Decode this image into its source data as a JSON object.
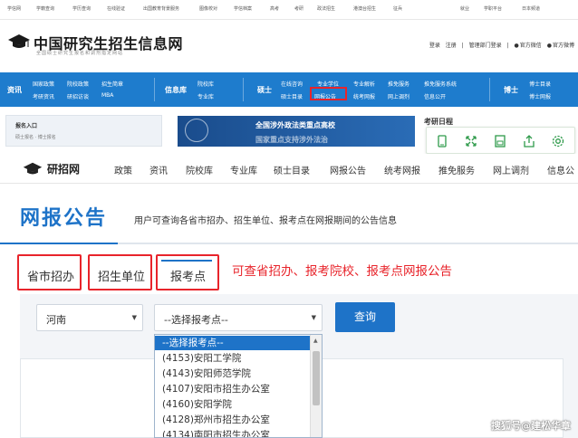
{
  "portal_links": [
    "学信网",
    "学籍查询",
    "学历查询",
    "在线验证",
    "出国教育背景服务",
    "图像校对",
    "学信档案",
    "高考",
    "考研",
    "政法招生",
    "港澳台招生",
    "征兵",
    "就业",
    "学职平台",
    "日本频道"
  ],
  "chsi": {
    "title": "中国研究生招生信息网",
    "subtitle": "全国硕士研究生报名和调剂指定网站",
    "login": "登录",
    "register": "注册",
    "admin_login": "管理部门登录",
    "wechat": "官方微信",
    "weibo": "官方微博"
  },
  "bluenav": {
    "zixun": {
      "header": "资讯",
      "items": [
        "国家政策",
        "院校政策",
        "招生简章",
        "考研资讯",
        "研招访谈",
        "MBA"
      ]
    },
    "xinxiku": {
      "header": "信息库",
      "items": [
        "院校库",
        "专业库"
      ]
    },
    "shuoshi": {
      "header": "硕士",
      "row1": [
        "在线咨询",
        "专业学位",
        "专业解析",
        "推免服务",
        "推免服务系统"
      ],
      "row2": [
        "硕士目录",
        "网报公告",
        "统考网报",
        "网上调剂",
        "信息公开"
      ]
    },
    "boshi": {
      "header": "博士",
      "items": [
        "博士目录",
        "博士网报"
      ]
    }
  },
  "middle": {
    "signup_entry": "报名入口",
    "signup_links": "硕士报名 · 博士报名",
    "banner_line1": "全国涉外政法类重点高校",
    "banner_line2": "国家重点支持涉外法治",
    "calendar": "考研日程"
  },
  "toolbar_icons": [
    "tablet-icon",
    "expand-icon",
    "save-icon",
    "share-icon",
    "settings-icon"
  ],
  "yzw": {
    "title": "研招网",
    "nav": [
      "政策",
      "资讯",
      "院校库",
      "专业库",
      "硕士目录",
      "网报公告",
      "统考网报",
      "推免服务",
      "网上调剂",
      "信息公"
    ]
  },
  "page": {
    "title": "网报公告",
    "description": "用户可查询各省市招办、招生单位、报考点在网报期间的公告信息"
  },
  "tabs": [
    "省市招办",
    "招生单位",
    "报考点"
  ],
  "annotation": "可查省招办、报考院校、报考点网报公告",
  "filters": {
    "province": "河南",
    "point_placeholder": "--选择报考点--",
    "query_button": "查询"
  },
  "dropdown_options": [
    "--选择报考点--",
    "(4153)安阳工学院",
    "(4143)安阳师范学院",
    "(4107)安阳市招生办公室",
    "(4160)安阳学院",
    "(4128)郑州市招生办公室",
    "(4134)南阳市招生办公室"
  ],
  "watermark": "搜狐号@建松华章",
  "colors": {
    "brand_blue": "#1e73c8",
    "nav_blue": "#1e7ccd",
    "highlight_red": "#e8242b"
  }
}
